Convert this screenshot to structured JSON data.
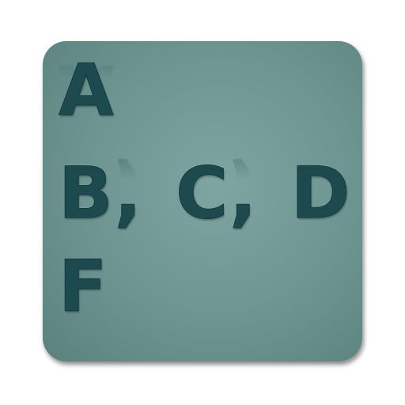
{
  "tile": {
    "row1": "A",
    "row2": "B, C, D",
    "row3": "F"
  },
  "colors": {
    "tile_background": "#6c9490",
    "letters": "#1d4a4f",
    "page_background": "#ffffff"
  }
}
